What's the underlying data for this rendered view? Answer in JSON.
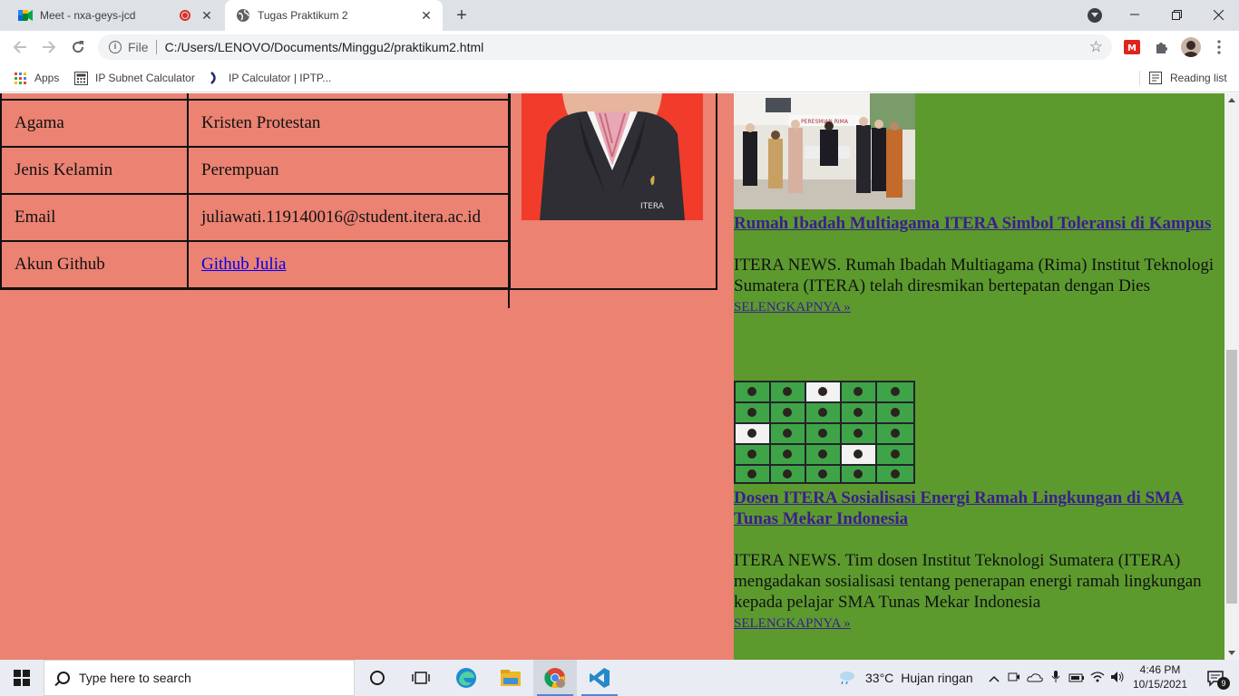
{
  "browser": {
    "tabs": [
      {
        "title": "Meet - nxa-geys-jcd",
        "active": false,
        "recording": true
      },
      {
        "title": "Tugas Praktikum 2",
        "active": true
      }
    ],
    "address": {
      "scheme_label": "File",
      "url": "C:/Users/LENOVO/Documents/Minggu2/praktikum2.html"
    },
    "bookmarks": [
      {
        "label": "Apps",
        "icon": "apps-grid-icon"
      },
      {
        "label": "IP Subnet Calculator",
        "icon": "calculator-icon"
      },
      {
        "label": "IP Calculator | IPTP...",
        "icon": "iptp-icon"
      }
    ],
    "reading_list": "Reading list"
  },
  "profile": {
    "rows": [
      {
        "key": "Agama",
        "value": "Kristen Protestan"
      },
      {
        "key": "Jenis Kelamin",
        "value": "Perempuan"
      },
      {
        "key": "Email",
        "value": "juliawati.119140016@student.itera.ac.id"
      },
      {
        "key": "Akun Github",
        "value": "Github Julia",
        "is_link": true
      }
    ],
    "photo_badge": "ITERA"
  },
  "news": [
    {
      "headline": "Rumah Ibadah Multiagama ITERA Simbol Toleransi di Kampus",
      "body": "ITERA NEWS. Rumah Ibadah Multiagama (Rima) Institut Teknologi Sumatera (ITERA) telah diresmikan bertepatan dengan Dies",
      "more": "SELENGKAPNYA »",
      "banner_text": "PERESMIAN RIMA"
    },
    {
      "headline": "Dosen ITERA Sosialisasi Energi Ramah Lingkungan di SMA Tunas Mekar Indonesia",
      "body": "ITERA NEWS. Tim dosen Institut Teknologi Sumatera (ITERA) mengadakan sosialisasi tentang penerapan energi ramah lingkungan kepada pelajar SMA Tunas Mekar Indonesia",
      "more": "SELENGKAPNYA »"
    }
  ],
  "taskbar": {
    "search_placeholder": "Type here to search",
    "weather_temp": "33°C",
    "weather_text": "Hujan ringan",
    "time": "4:46 PM",
    "date": "10/15/2021",
    "notification_count": "9"
  },
  "colors": {
    "left_bg": "#eb8272",
    "right_bg": "#5c9a2e",
    "photo_bg": "#f13c2c",
    "link": "#0000ee",
    "visited_link": "#3b1d8f"
  }
}
